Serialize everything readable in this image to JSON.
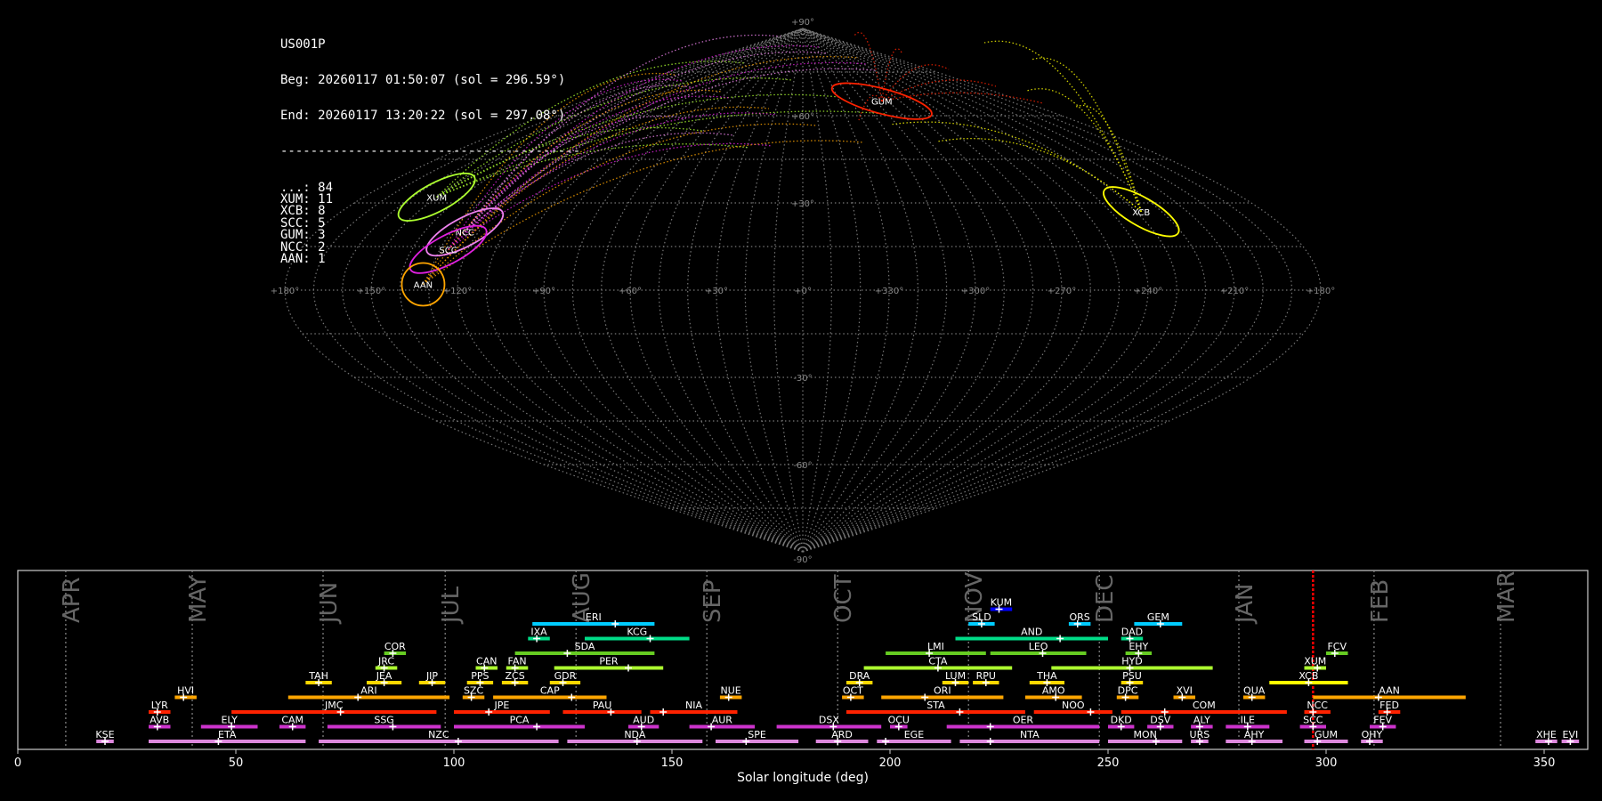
{
  "info": {
    "station": "US001P",
    "begin": "Beg: 20260117 01:50:07 (sol = 296.59°)",
    "end": "End: 20260117 13:20:22 (sol = 297.08°)",
    "separator": "----------------------------------------",
    "counts": [
      {
        "code": "...",
        "n": 84
      },
      {
        "code": "XUM",
        "n": 11
      },
      {
        "code": "XCB",
        "n": 8
      },
      {
        "code": "SCC",
        "n": 5
      },
      {
        "code": "GUM",
        "n": 3
      },
      {
        "code": "NCC",
        "n": 2
      },
      {
        "code": "AAN",
        "n": 1
      }
    ]
  },
  "colors": {
    "XUM": "#adff2f",
    "XCB": "#ffff00",
    "SCC": "#e020e0",
    "NCC": "#ee82ee",
    "GUM": "#ff2200",
    "AAN": "#ffa500",
    "sporadic": "#808080",
    "current_sol": "#ff0000"
  },
  "chart_data": [
    {
      "type": "scatter",
      "title": "",
      "projection": "sinusoidal (sky map, ecliptic)",
      "lon_ticks": [
        "+180°",
        "+150°",
        "+120°",
        "+90°",
        "+60°",
        "+30°",
        "+0°",
        "+330°",
        "+300°",
        "+270°",
        "+240°",
        "+210°",
        "+180°"
      ],
      "lat_ticks": [
        "+90°",
        "+60°",
        "+30°",
        "-30°",
        "-60°",
        "-90°"
      ],
      "grid": true,
      "radiants": [
        {
          "name": "GUM",
          "lon": 295,
          "lat": 65,
          "color": "#ff2200"
        },
        {
          "name": "XUM",
          "lon": 150,
          "lat": 32,
          "color": "#adff2f"
        },
        {
          "name": "XCB",
          "lon": 228,
          "lat": 27,
          "color": "#ffff00"
        },
        {
          "name": "NCC",
          "lon": 125,
          "lat": 20,
          "color": "#ee82ee"
        },
        {
          "name": "SCC",
          "lon": 127,
          "lat": 14,
          "color": "#e020e0"
        },
        {
          "name": "AAN",
          "lon": 132,
          "lat": 2,
          "color": "#ffa500"
        }
      ]
    },
    {
      "type": "bar",
      "xlabel": "Solar longitude (deg)",
      "xlim": [
        0,
        360
      ],
      "xticks": [
        0,
        50,
        100,
        150,
        200,
        250,
        300,
        350
      ],
      "months": [
        {
          "label": "APR",
          "start": 11,
          "end": 40
        },
        {
          "label": "MAY",
          "start": 40,
          "end": 70
        },
        {
          "label": "JUN",
          "start": 70,
          "end": 98
        },
        {
          "label": "JUL",
          "start": 98,
          "end": 128
        },
        {
          "label": "AUG",
          "start": 128,
          "end": 158
        },
        {
          "label": "SEP",
          "start": 158,
          "end": 188
        },
        {
          "label": "OCT",
          "start": 188,
          "end": 218
        },
        {
          "label": "NOV",
          "start": 218,
          "end": 248
        },
        {
          "label": "DEC",
          "start": 248,
          "end": 280
        },
        {
          "label": "JAN",
          "start": 280,
          "end": 311
        },
        {
          "label": "FEB",
          "start": 311,
          "end": 340
        },
        {
          "label": "MAR",
          "start": 340,
          "end": 371
        }
      ],
      "current_sol": 297,
      "showers": [
        {
          "code": "KUM",
          "row": 9,
          "start": 223,
          "end": 228,
          "peak": 225,
          "color": "#0000ff"
        },
        {
          "code": "SLD",
          "row": 8,
          "start": 218,
          "end": 224,
          "peak": 221,
          "color": "#00ccff"
        },
        {
          "code": "ORS",
          "row": 8,
          "start": 241,
          "end": 246,
          "peak": 243,
          "color": "#00ccff"
        },
        {
          "code": "GEM",
          "row": 8,
          "start": 256,
          "end": 267,
          "peak": 262,
          "color": "#00ccff"
        },
        {
          "code": "ERI",
          "row": 8,
          "start": 118,
          "end": 146,
          "peak": 137,
          "color": "#00ccff"
        },
        {
          "code": "IXA",
          "row": 7,
          "start": 117,
          "end": 122,
          "peak": 119,
          "color": "#00dd88"
        },
        {
          "code": "KCG",
          "row": 7,
          "start": 130,
          "end": 154,
          "peak": 145,
          "color": "#00dd88"
        },
        {
          "code": "AND",
          "row": 7,
          "start": 215,
          "end": 250,
          "peak": 239,
          "color": "#00dd88"
        },
        {
          "code": "DAD",
          "row": 7,
          "start": 253,
          "end": 258,
          "peak": 255,
          "color": "#00dd88"
        },
        {
          "code": "COR",
          "row": 6,
          "start": 84,
          "end": 89,
          "peak": 86,
          "color": "#66cc22"
        },
        {
          "code": "SDA",
          "row": 6,
          "start": 114,
          "end": 146,
          "peak": 126,
          "color": "#66cc22"
        },
        {
          "code": "LMI",
          "row": 6,
          "start": 199,
          "end": 222,
          "peak": 209,
          "color": "#66cc22"
        },
        {
          "code": "LEO",
          "row": 6,
          "start": 223,
          "end": 245,
          "peak": 235,
          "color": "#66cc22"
        },
        {
          "code": "EHY",
          "row": 6,
          "start": 254,
          "end": 260,
          "peak": 257,
          "color": "#66cc22"
        },
        {
          "code": "FCV",
          "row": 6,
          "start": 300,
          "end": 305,
          "peak": 302,
          "color": "#66cc22"
        },
        {
          "code": "JRC",
          "row": 5,
          "start": 82,
          "end": 87,
          "peak": 84,
          "color": "#adff2f"
        },
        {
          "code": "CAN",
          "row": 5,
          "start": 105,
          "end": 110,
          "peak": 107,
          "color": "#adff2f"
        },
        {
          "code": "FAN",
          "row": 5,
          "start": 112,
          "end": 117,
          "peak": 114,
          "color": "#adff2f"
        },
        {
          "code": "PER",
          "row": 5,
          "start": 123,
          "end": 148,
          "peak": 140,
          "color": "#adff2f"
        },
        {
          "code": "CTA",
          "row": 5,
          "start": 194,
          "end": 228,
          "peak": 211,
          "color": "#adff2f"
        },
        {
          "code": "HYD",
          "row": 5,
          "start": 237,
          "end": 274,
          "peak": 255,
          "color": "#adff2f"
        },
        {
          "code": "XUM",
          "row": 5,
          "start": 295,
          "end": 300,
          "peak": 298,
          "color": "#adff2f"
        },
        {
          "code": "TAH",
          "row": 4,
          "start": 66,
          "end": 72,
          "peak": 69,
          "color": "#ffd700"
        },
        {
          "code": "JEA",
          "row": 4,
          "start": 80,
          "end": 88,
          "peak": 84,
          "color": "#ffd700"
        },
        {
          "code": "JIP",
          "row": 4,
          "start": 92,
          "end": 98,
          "peak": 95,
          "color": "#ffd700"
        },
        {
          "code": "PPS",
          "row": 4,
          "start": 103,
          "end": 109,
          "peak": 106,
          "color": "#ffd700"
        },
        {
          "code": "ZCS",
          "row": 4,
          "start": 111,
          "end": 117,
          "peak": 114,
          "color": "#ffd700"
        },
        {
          "code": "GDR",
          "row": 4,
          "start": 122,
          "end": 129,
          "peak": 125,
          "color": "#ffd700"
        },
        {
          "code": "DRA",
          "row": 4,
          "start": 190,
          "end": 196,
          "peak": 193,
          "color": "#ffd700"
        },
        {
          "code": "LUM",
          "row": 4,
          "start": 212,
          "end": 218,
          "peak": 215,
          "color": "#ffd700"
        },
        {
          "code": "RPU",
          "row": 4,
          "start": 219,
          "end": 225,
          "peak": 222,
          "color": "#ffd700"
        },
        {
          "code": "THA",
          "row": 4,
          "start": 232,
          "end": 240,
          "peak": 236,
          "color": "#ffd700"
        },
        {
          "code": "PSU",
          "row": 4,
          "start": 253,
          "end": 258,
          "peak": 255,
          "color": "#ffd700"
        },
        {
          "code": "XCB",
          "row": 4,
          "start": 287,
          "end": 305,
          "peak": 296,
          "color": "#ffff00"
        },
        {
          "code": "HVI",
          "row": 3,
          "start": 36,
          "end": 41,
          "peak": 38,
          "color": "#ffa500"
        },
        {
          "code": "ARI",
          "row": 3,
          "start": 62,
          "end": 99,
          "peak": 78,
          "color": "#ffa500"
        },
        {
          "code": "SZC",
          "row": 3,
          "start": 102,
          "end": 107,
          "peak": 104,
          "color": "#ffa500"
        },
        {
          "code": "CAP",
          "row": 3,
          "start": 109,
          "end": 135,
          "peak": 127,
          "color": "#ffa500"
        },
        {
          "code": "NUE",
          "row": 3,
          "start": 161,
          "end": 166,
          "peak": 163,
          "color": "#ffa500"
        },
        {
          "code": "OCT",
          "row": 3,
          "start": 189,
          "end": 194,
          "peak": 191,
          "color": "#ffa500"
        },
        {
          "code": "ORI",
          "row": 3,
          "start": 198,
          "end": 226,
          "peak": 208,
          "color": "#ffa500"
        },
        {
          "code": "AMO",
          "row": 3,
          "start": 231,
          "end": 244,
          "peak": 238,
          "color": "#ffa500"
        },
        {
          "code": "DPC",
          "row": 3,
          "start": 252,
          "end": 257,
          "peak": 254,
          "color": "#ffa500"
        },
        {
          "code": "XVI",
          "row": 3,
          "start": 265,
          "end": 270,
          "peak": 267,
          "color": "#ffa500"
        },
        {
          "code": "QUA",
          "row": 3,
          "start": 281,
          "end": 286,
          "peak": 283,
          "color": "#ffa500"
        },
        {
          "code": "AAN",
          "row": 3,
          "start": 297,
          "end": 332,
          "peak": 312,
          "color": "#ffa500"
        },
        {
          "code": "LYR",
          "row": 2,
          "start": 30,
          "end": 35,
          "peak": 32,
          "color": "#ff2200"
        },
        {
          "code": "JMC",
          "row": 2,
          "start": 49,
          "end": 96,
          "peak": 74,
          "color": "#ff2200"
        },
        {
          "code": "JPE",
          "row": 2,
          "start": 100,
          "end": 122,
          "peak": 108,
          "color": "#ff2200"
        },
        {
          "code": "PAU",
          "row": 2,
          "start": 125,
          "end": 143,
          "peak": 136,
          "color": "#ff2200"
        },
        {
          "code": "NIA",
          "row": 2,
          "start": 145,
          "end": 165,
          "peak": 148,
          "color": "#ff2200"
        },
        {
          "code": "STA",
          "row": 2,
          "start": 190,
          "end": 231,
          "peak": 216,
          "color": "#ff2200"
        },
        {
          "code": "NOO",
          "row": 2,
          "start": 233,
          "end": 251,
          "peak": 246,
          "color": "#ff2200"
        },
        {
          "code": "COM",
          "row": 2,
          "start": 253,
          "end": 291,
          "peak": 263,
          "color": "#ff2200"
        },
        {
          "code": "NCC",
          "row": 2,
          "start": 295,
          "end": 301,
          "peak": 297,
          "color": "#ff2200"
        },
        {
          "code": "FED",
          "row": 2,
          "start": 312,
          "end": 317,
          "peak": 314,
          "color": "#ff2200"
        },
        {
          "code": "AVB",
          "row": 1,
          "start": 30,
          "end": 35,
          "peak": 32,
          "color": "#cc33cc"
        },
        {
          "code": "ELY",
          "row": 1,
          "start": 42,
          "end": 55,
          "peak": 49,
          "color": "#cc33cc"
        },
        {
          "code": "CAM",
          "row": 1,
          "start": 60,
          "end": 66,
          "peak": 63,
          "color": "#cc33cc"
        },
        {
          "code": "SSG",
          "row": 1,
          "start": 71,
          "end": 97,
          "peak": 86,
          "color": "#cc33cc"
        },
        {
          "code": "PCA",
          "row": 1,
          "start": 100,
          "end": 130,
          "peak": 119,
          "color": "#cc33cc"
        },
        {
          "code": "AUD",
          "row": 1,
          "start": 140,
          "end": 147,
          "peak": 143,
          "color": "#cc33cc"
        },
        {
          "code": "AUR",
          "row": 1,
          "start": 154,
          "end": 169,
          "peak": 159,
          "color": "#cc33cc"
        },
        {
          "code": "DSX",
          "row": 1,
          "start": 174,
          "end": 198,
          "peak": 187,
          "color": "#cc33cc"
        },
        {
          "code": "OCU",
          "row": 1,
          "start": 200,
          "end": 204,
          "peak": 202,
          "color": "#cc33cc"
        },
        {
          "code": "OER",
          "row": 1,
          "start": 213,
          "end": 248,
          "peak": 223,
          "color": "#cc33cc"
        },
        {
          "code": "DKD",
          "row": 1,
          "start": 250,
          "end": 256,
          "peak": 253,
          "color": "#cc33cc"
        },
        {
          "code": "DSV",
          "row": 1,
          "start": 259,
          "end": 265,
          "peak": 262,
          "color": "#cc33cc"
        },
        {
          "code": "ALY",
          "row": 1,
          "start": 269,
          "end": 274,
          "peak": 271,
          "color": "#cc33cc"
        },
        {
          "code": "ILE",
          "row": 1,
          "start": 277,
          "end": 287,
          "peak": 282,
          "color": "#cc33cc"
        },
        {
          "code": "SCC",
          "row": 1,
          "start": 294,
          "end": 300,
          "peak": 297,
          "color": "#cc33cc"
        },
        {
          "code": "FEV",
          "row": 1,
          "start": 310,
          "end": 316,
          "peak": 313,
          "color": "#cc33cc"
        },
        {
          "code": "KSE",
          "row": 0,
          "start": 18,
          "end": 22,
          "peak": 20,
          "color": "#dd88dd"
        },
        {
          "code": "ETA",
          "row": 0,
          "start": 30,
          "end": 66,
          "peak": 46,
          "color": "#dd88dd"
        },
        {
          "code": "NZC",
          "row": 0,
          "start": 69,
          "end": 124,
          "peak": 101,
          "color": "#dd88dd"
        },
        {
          "code": "NDA",
          "row": 0,
          "start": 126,
          "end": 157,
          "peak": 142,
          "color": "#dd88dd"
        },
        {
          "code": "SPE",
          "row": 0,
          "start": 160,
          "end": 179,
          "peak": 167,
          "color": "#dd88dd"
        },
        {
          "code": "ARD",
          "row": 0,
          "start": 183,
          "end": 195,
          "peak": 188,
          "color": "#dd88dd"
        },
        {
          "code": "EGE",
          "row": 0,
          "start": 197,
          "end": 214,
          "peak": 199,
          "color": "#dd88dd"
        },
        {
          "code": "NTA",
          "row": 0,
          "start": 216,
          "end": 248,
          "peak": 223,
          "color": "#dd88dd"
        },
        {
          "code": "MON",
          "row": 0,
          "start": 250,
          "end": 267,
          "peak": 261,
          "color": "#dd88dd"
        },
        {
          "code": "URS",
          "row": 0,
          "start": 269,
          "end": 273,
          "peak": 271,
          "color": "#dd88dd"
        },
        {
          "code": "AHY",
          "row": 0,
          "start": 277,
          "end": 290,
          "peak": 283,
          "color": "#dd88dd"
        },
        {
          "code": "GUM",
          "row": 0,
          "start": 295,
          "end": 305,
          "peak": 298,
          "color": "#dd88dd"
        },
        {
          "code": "OHY",
          "row": 0,
          "start": 308,
          "end": 313,
          "peak": 310,
          "color": "#dd88dd"
        },
        {
          "code": "XHE",
          "row": 0,
          "start": 348,
          "end": 353,
          "peak": 351,
          "color": "#dd88dd"
        },
        {
          "code": "EVI",
          "row": 0,
          "start": 354,
          "end": 358,
          "peak": 356,
          "color": "#dd88dd"
        }
      ]
    }
  ]
}
